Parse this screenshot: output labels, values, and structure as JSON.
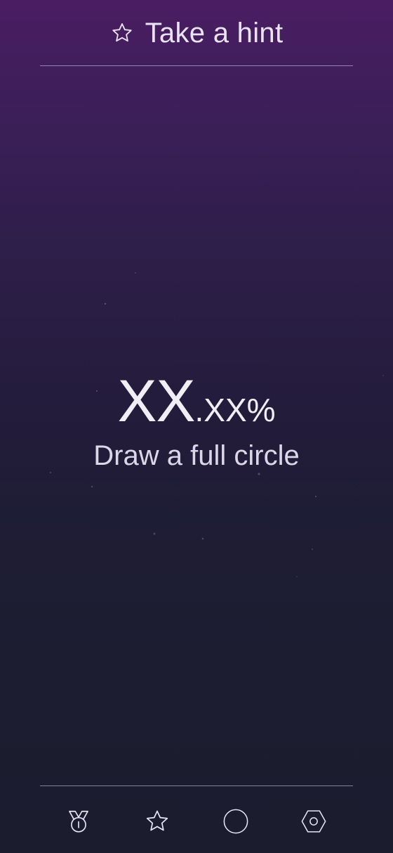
{
  "hint": {
    "label": "Take a hint",
    "icon": "star-outline-icon"
  },
  "score": {
    "integer_part": "XX",
    "decimal_part": ".XX%"
  },
  "subtitle": "Draw a full circle",
  "nav": {
    "items": [
      {
        "icon": "medal-icon"
      },
      {
        "icon": "star-icon"
      },
      {
        "icon": "circle-icon"
      },
      {
        "icon": "hexagon-settings-icon"
      }
    ]
  },
  "colors": {
    "background_top": "#4a1d63",
    "background_bottom": "#1b1c2e",
    "text": "#ebe7f2",
    "divider": "#e1d7f0"
  }
}
